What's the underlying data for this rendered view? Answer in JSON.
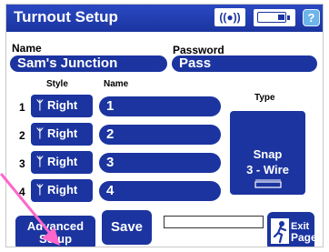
{
  "window": {
    "title": "Turnout Setup",
    "signal_icon_text": "((●))",
    "help_label": "?"
  },
  "fields": {
    "name_label": "Name",
    "name_value": "Sam's Junction",
    "password_label": "Password",
    "password_value": "Pass"
  },
  "table": {
    "style_header": "Style",
    "name_header": "Name",
    "rows": [
      {
        "num": "1",
        "style": "Right",
        "name": "1"
      },
      {
        "num": "2",
        "style": "Right",
        "name": "2"
      },
      {
        "num": "3",
        "style": "Right",
        "name": "3"
      },
      {
        "num": "4",
        "style": "Right",
        "name": "4"
      }
    ]
  },
  "type": {
    "label": "Type",
    "line1": "Snap",
    "line2": "3 - Wire"
  },
  "buttons": {
    "advanced_line1": "Advanced",
    "advanced_line2": "Setup",
    "save": "Save",
    "exit_line1": "Exit",
    "exit_line2": "Page"
  },
  "colors": {
    "accent": "#1b34a0",
    "help": "#6db4e8",
    "pointer": "#ff66cc"
  },
  "icons": {
    "switch_style": "turnout-switch-icon",
    "exit": "exit-door-icon"
  }
}
